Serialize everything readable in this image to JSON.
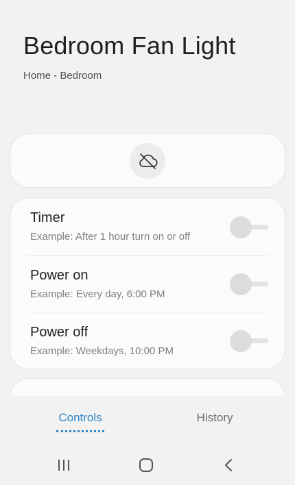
{
  "header": {
    "title": "Bedroom Fan Light",
    "location": "Home - Bedroom"
  },
  "status": {
    "icon": "cloud-off-icon"
  },
  "schedules": [
    {
      "title": "Timer",
      "example": "Example: After 1 hour turn on or off",
      "enabled": false
    },
    {
      "title": "Power on",
      "example": "Example: Every day, 6:00 PM",
      "enabled": false
    },
    {
      "title": "Power off",
      "example": "Example: Weekdays, 10:00 PM",
      "enabled": false
    }
  ],
  "tabs": {
    "controls": "Controls",
    "history": "History",
    "active": "Controls"
  },
  "nav": {
    "recent_icon": "recent-apps-icon",
    "home_icon": "home-icon",
    "back_icon": "back-icon"
  },
  "colors": {
    "accent": "#2f86c7",
    "background": "#f2f2f2",
    "card": "#fbfbfb"
  }
}
